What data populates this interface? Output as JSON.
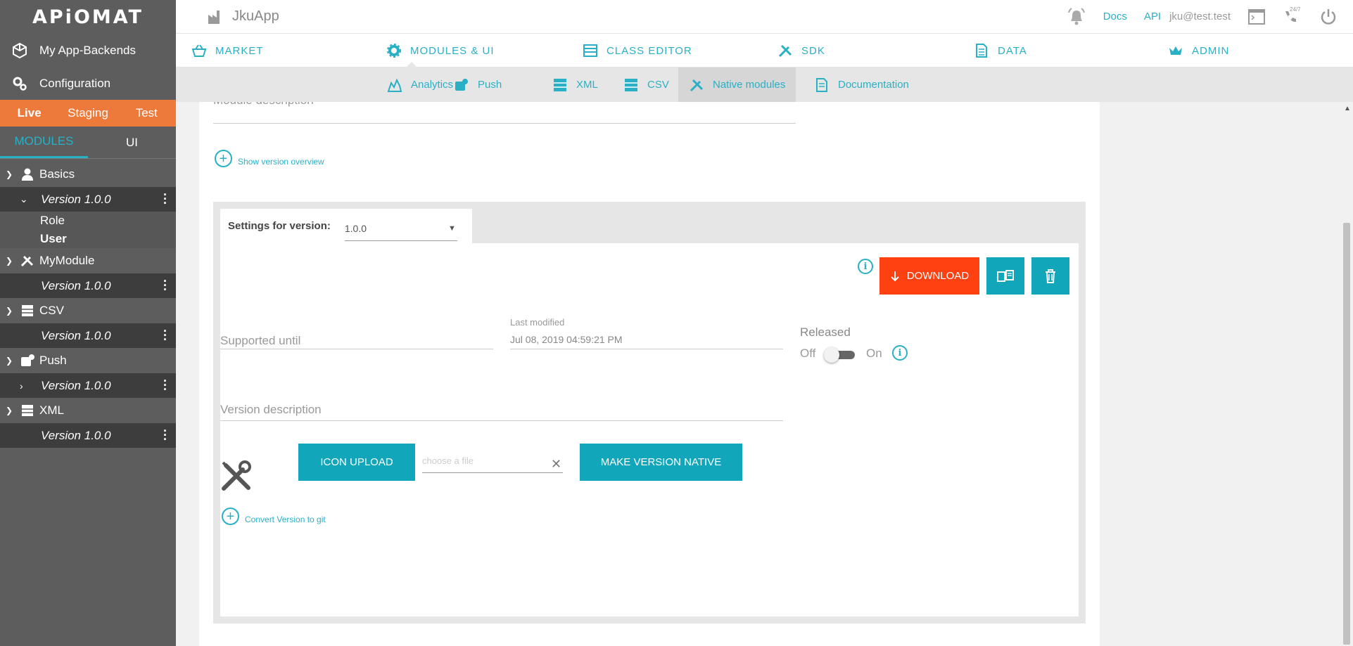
{
  "sidebar": {
    "logo": "APiOMAT",
    "links": {
      "backends": "My App-Backends",
      "configuration": "Configuration"
    },
    "environments": [
      "Live",
      "Staging",
      "Test"
    ],
    "tabs": {
      "modules": "MODULES",
      "ui": "UI"
    },
    "modules": [
      {
        "name": "Basics",
        "version": "Version 1.0.0",
        "classes": [
          "Role",
          "User"
        ]
      },
      {
        "name": "MyModule",
        "version": "Version 1.0.0"
      },
      {
        "name": "CSV",
        "version": "Version 1.0.0"
      },
      {
        "name": "Push",
        "version": "Version 1.0.0"
      },
      {
        "name": "XML",
        "version": "Version 1.0.0"
      }
    ]
  },
  "topbar": {
    "app_name": "JkuApp",
    "docs": "Docs",
    "api": "API",
    "user": "jku@test.test",
    "support_badge": "24/7"
  },
  "mainnav": {
    "market": "MARKET",
    "modules_ui": "MODULES & UI",
    "class_editor": "CLASS EDITOR",
    "sdk": "SDK",
    "data": "DATA",
    "admin": "ADMIN"
  },
  "subnav": {
    "analytics": "Analytics",
    "push": "Push",
    "xml": "XML",
    "csv": "CSV",
    "native_modules": "Native modules",
    "documentation": "Documentation"
  },
  "content": {
    "module_description_label": "Module description",
    "show_version_overview": "Show version overview",
    "settings_for_version_label": "Settings for version:",
    "selected_version": "1.0.0",
    "download_label": "DOWNLOAD",
    "supported_until_label": "Supported until",
    "last_modified_label": "Last modified",
    "last_modified_value": "Jul 08, 2019 04:59:21 PM",
    "released_label": "Released",
    "off_label": "Off",
    "on_label": "On",
    "version_description_label": "Version description",
    "icon_upload_label": "ICON UPLOAD",
    "choose_file_placeholder": "choose a file",
    "make_native_label": "MAKE VERSION NATIVE",
    "convert_to_git": "Convert Version to git"
  },
  "colors": {
    "accent": "#2ab0c5",
    "button": "#12a6bb",
    "download": "#ff4010",
    "env_bar": "#ed7a3a",
    "sidebar": "#5d5d5d"
  }
}
